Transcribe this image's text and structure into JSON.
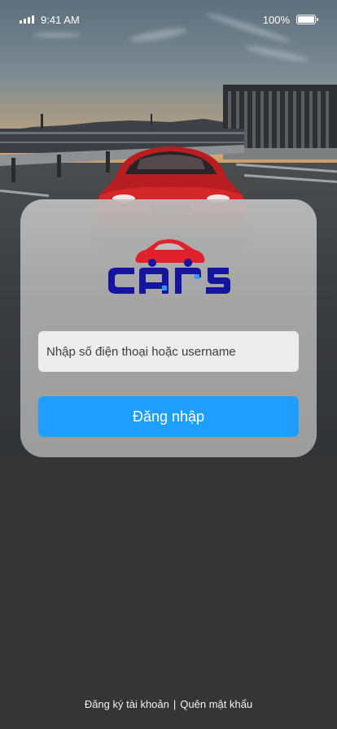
{
  "status_bar": {
    "time": "9:41 AM",
    "battery": "100%",
    "battery_level": 1.0
  },
  "brand": {
    "logo_text": "cars",
    "logo_color": "#1414a0",
    "logo_accent_color": "#e0202b"
  },
  "login_form": {
    "username_placeholder": "Nhập số điện thoại hoặc username",
    "username_value": "",
    "submit_label": "Đăng nhập",
    "button_color": "#1e9fff"
  },
  "footer": {
    "register_label": "Đăng ký tài khoản",
    "separator": "|",
    "forgot_password_label": "Quên mật khẩu"
  },
  "icons": [
    "signal-icon",
    "battery-icon",
    "car-logo-icon"
  ]
}
